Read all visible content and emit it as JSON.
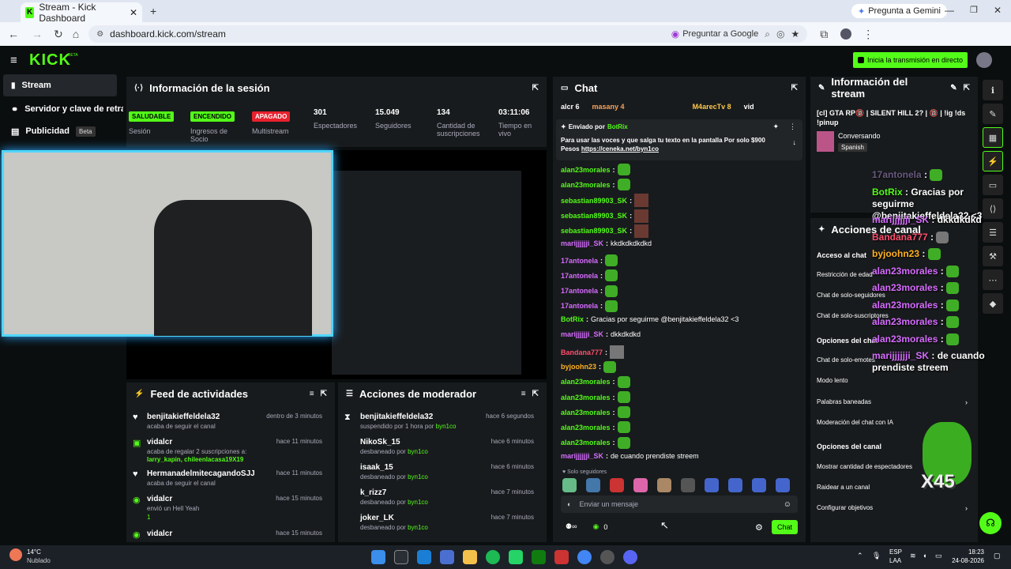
{
  "browser": {
    "tab_title": "Stream - Kick Dashboard",
    "url": "dashboard.kick.com/stream",
    "gemini": "Pregunta a Gemini",
    "ask_google": "Preguntar a Google"
  },
  "header": {
    "logo": "KICK",
    "beta": "BETA",
    "go_live": "Inicia la transmisión en directo"
  },
  "sidebar": {
    "items": [
      {
        "label": "Stream"
      },
      {
        "label": "Servidor y clave de retran"
      },
      {
        "label": "Publicidad",
        "badge": "Beta"
      }
    ]
  },
  "session": {
    "title": "Información de la sesión",
    "stats": [
      {
        "badge": "SALUDABLE",
        "label": "Sesión"
      },
      {
        "badge": "ENCENDIDO",
        "label": "Ingresos de Socio"
      },
      {
        "badge": "APAGADO",
        "label": "Multistream"
      },
      {
        "value": "301",
        "label": "Espectadores"
      },
      {
        "value": "15.049",
        "label": "Seguidores"
      },
      {
        "value": "134",
        "label": "Cantidad de suscripciones"
      },
      {
        "value": "03:11:06",
        "label": "Tiempo en vivo"
      }
    ]
  },
  "feed": {
    "title": "Feed de actividades",
    "items": [
      {
        "name": "benjitakieffeldela32",
        "time": "dentro de 3 minutos",
        "sub": "acaba de seguir el canal"
      },
      {
        "name": "vidalcr",
        "time": "hace 11 minutos",
        "sub": "acaba de regalar 2 suscripciones a:",
        "extra": "larry_kapin, chileenlacasa19X19"
      },
      {
        "name": "HermanadelmitecagandoSJJ",
        "time": "hace 11 minutos",
        "sub": "acaba de seguir el canal"
      },
      {
        "name": "vidalcr",
        "time": "hace 15 minutos",
        "sub": "envió un Hell Yeah",
        "extra": "1"
      },
      {
        "name": "vidalcr",
        "time": "hace 15 minutos",
        "sub": ""
      }
    ]
  },
  "mod": {
    "title": "Acciones de moderador",
    "items": [
      {
        "name": "benjitakieffeldela32",
        "time": "hace 6 segundos",
        "sub": "suspendido por 1 hora por",
        "by": "byn1co"
      },
      {
        "name": "NikoSk_15",
        "time": "hace 6 minutos",
        "sub": "desbaneado por",
        "by": "byn1co"
      },
      {
        "name": "isaak_15",
        "time": "hace 6 minutos",
        "sub": "desbaneado por",
        "by": "byn1co"
      },
      {
        "name": "k_rizz7",
        "time": "hace 7 minutos",
        "sub": "desbaneado por",
        "by": "byn1co"
      },
      {
        "name": "joker_LK",
        "time": "hace 7 minutos",
        "sub": "desbaneado por",
        "by": "byn1co"
      }
    ]
  },
  "chat": {
    "title": "Chat",
    "top_users": [
      "alcr 6",
      "masany 4",
      "M4arecTv 8",
      "vid"
    ],
    "pinned_by": "Enviado por",
    "pinned_user": "BotRix",
    "pinned_text": "Para usar las voces y que salga tu texto en la pantalla Por solo $900 Pesos",
    "pinned_link": "https://ceneka.net/byn1co",
    "messages": [
      {
        "user": "alan23morales",
        "text": "",
        "color": "#53fc18"
      },
      {
        "user": "alan23morales",
        "text": "",
        "color": "#53fc18"
      },
      {
        "user": "sebastian89903_SK",
        "text": "",
        "color": "#53fc18"
      },
      {
        "user": "sebastian89903_SK",
        "text": "",
        "color": "#53fc18"
      },
      {
        "user": "sebastian89903_SK",
        "text": "",
        "color": "#53fc18"
      },
      {
        "user": "marijjjjjji_SK",
        "text": "kkdkdkdkdkd",
        "color": "#d66cff"
      },
      {
        "user": "17antonela",
        "text": "",
        "color": "#d66cff"
      },
      {
        "user": "17antonela",
        "text": "",
        "color": "#d66cff"
      },
      {
        "user": "17antonela",
        "text": "",
        "color": "#d66cff"
      },
      {
        "user": "17antonela",
        "text": "",
        "color": "#d66cff"
      },
      {
        "user": "BotRix",
        "text": "Gracias por seguirme @benjitakieffeldela32 <3",
        "color": "#53fc18"
      },
      {
        "user": "marijjjjjji_SK",
        "text": "dkkdkdkd",
        "color": "#d66cff"
      },
      {
        "user": "Bandana777",
        "text": "",
        "color": "#ff4d6d"
      },
      {
        "user": "byjoohn23",
        "text": "",
        "color": "#ffb020"
      },
      {
        "user": "alan23morales",
        "text": "",
        "color": "#53fc18"
      },
      {
        "user": "alan23morales",
        "text": "",
        "color": "#53fc18"
      },
      {
        "user": "alan23morales",
        "text": "",
        "color": "#53fc18"
      },
      {
        "user": "alan23morales",
        "text": "",
        "color": "#53fc18"
      },
      {
        "user": "alan23morales",
        "text": "",
        "color": "#53fc18"
      },
      {
        "user": "marijjjjjji_SK",
        "text": "de cuando prendiste streem",
        "color": "#d66cff"
      }
    ],
    "followers_only": "Solo seguidores",
    "input_placeholder": "Enviar un mensaje",
    "points": "0",
    "send": "Chat"
  },
  "stream_info": {
    "title": "Información del stream",
    "stream_title": "[cl] GTA RP🔞 | SILENT HILL 2? | 🔞 | !ig !ds !pinup",
    "category": "Conversando",
    "language": "Spanish"
  },
  "channel_actions": {
    "title": "Acciones de canal",
    "access": "Acceso al chat",
    "items": [
      "Restricción de edad",
      "Chat de solo-seguidores",
      "Chat de solo-suscriptores"
    ],
    "chat_options": "Opciones del chat",
    "opt_items": [
      "Chat de solo-emotes",
      "Modo lento",
      "Palabras baneadas",
      "Moderación del chat con IA"
    ],
    "channel_options": "Opciones del canal",
    "ch_items": [
      "Mostrar cantidad de espectadores",
      "Raidear a un canal",
      "Configurar objetivos"
    ]
  },
  "overlay": {
    "lines": [
      {
        "user": "17antonela",
        "text": ""
      },
      {
        "user": "BotRix",
        "text": "Gracias por seguirme @benjitakieffeldela32 <3"
      },
      {
        "user": "marijjjjjji_SK",
        "text": "dkkdkdkd"
      },
      {
        "user": "Bandana777",
        "text": ""
      },
      {
        "user": "byjoohn23",
        "text": ""
      },
      {
        "user": "alan23morales",
        "text": ""
      },
      {
        "user": "alan23morales",
        "text": ""
      },
      {
        "user": "alan23morales",
        "text": ""
      },
      {
        "user": "alan23morales",
        "text": ""
      },
      {
        "user": "alan23morales",
        "text": ""
      },
      {
        "user": "marijjjjjji_SK",
        "text": "de cuando prendiste streem"
      }
    ],
    "x45": "X45"
  },
  "taskbar": {
    "temp": "14°C",
    "weather": "Nublado",
    "lang": "ESP",
    "layout": "LAA",
    "time": "18:23",
    "date": "24-08-2026"
  }
}
